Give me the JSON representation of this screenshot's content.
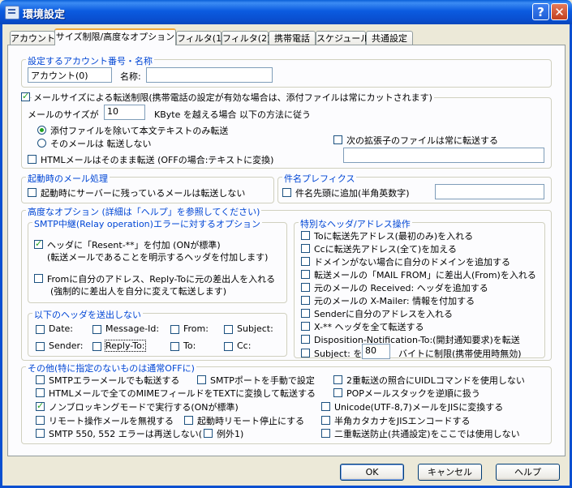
{
  "window": {
    "title": "環境設定",
    "help_btn": "?",
    "close_btn": "✕"
  },
  "tabs": [
    {
      "label": "アカウント",
      "active": false
    },
    {
      "label": "サイズ制限/高度なオプション",
      "active": true
    },
    {
      "label": "フィルタ(1)",
      "active": false
    },
    {
      "label": "フィルタ(2)",
      "active": false
    },
    {
      "label": "携帯電話",
      "active": false
    },
    {
      "label": "スケジュール",
      "active": false
    },
    {
      "label": "共通設定",
      "active": false
    }
  ],
  "account": {
    "group_title": "設定するアカウント番号・名称",
    "number_value": "アカウント(0)",
    "name_label": "名称:",
    "name_value": ""
  },
  "size_limit": {
    "enable_label": "メールサイズによる転送制限(携帯電話の設定が有効な場合は、添付ファイルは常にカットされます)",
    "size_prefix": "メールのサイズが",
    "size_value": "10",
    "size_suffix": "KByte を越える場合 以下の方法に従う",
    "radio_strip": "添付ファイルを除いて本文テキストのみ転送",
    "radio_skip": "そのメールは 転送しない",
    "html_label": "HTMLメールはそのまま転送 (OFFの場合:テキストに変換)",
    "ext_label": "次の拡張子のファイルは常に転送する",
    "ext_value": ""
  },
  "startup": {
    "group_title": "起動時のメール処理",
    "skip_label": "起動時にサーバーに残っているメールは転送しない"
  },
  "prefix": {
    "group_title": "件名プレフィクス",
    "add_label": "件名先頭に追加(半角英数字)",
    "value": ""
  },
  "advanced": {
    "group_title": "高度なオプション (詳細は「ヘルプ」を参照してください)",
    "smtp_title": "SMTP中継(Relay operation)エラーに対するオプション",
    "resent_line1": "ヘッダに「Resent-**」を付加 (ONが標準)",
    "resent_line2": "(転送メールであることを明示するヘッダを付加します)",
    "from_line1": "Fromに自分のアドレス、Reply-Toに元の差出人を入れる",
    "from_line2": "(強制的に差出人を自分に変えて転送します)",
    "noheader_title": "以下のヘッダを送出しない",
    "headers": [
      "Date:",
      "Message-Id:",
      "From:",
      "Subject:",
      "Sender:",
      "Reply-To:",
      "To:",
      "Cc:"
    ]
  },
  "special": {
    "group_title": "特別なヘッダ/アドレス操作",
    "items": [
      "Toに転送先アドレス(最初のみ)を入れる",
      "Ccに転送先アドレス(全て)を加える",
      "ドメインがない場合に自分のドメインを追加する",
      "転送メールの「MAIL FROM」に差出人(From)を入れる",
      "元のメールの Received: ヘッダを追加する",
      "元のメールの X-Mailer: 情報を付加する",
      "Senderに自分のアドレスを入れる",
      "X-** ヘッダを全て転送する",
      "Disposition-Notification-To:(開封通知要求)を転送"
    ],
    "subject_prefix": "Subject: を",
    "subject_value": "80",
    "subject_suffix": "バイトに制限(携帯使用時無効)"
  },
  "other": {
    "group_title": "その他(特に指定のないものは通常OFFに)",
    "col1": [
      {
        "label": "SMTPエラーメールでも転送する",
        "checked": false
      },
      {
        "label": "HTMLメールで全てのMIMEフィールドをTEXTに変換して転送する",
        "checked": false
      },
      {
        "label": "ノンブロッキングモードで実行する(ONが標準)",
        "checked": true
      },
      {
        "label": "リモート操作メールを無視する",
        "checked": false
      },
      {
        "label": "SMTP 550, 552 エラーは再送しない(",
        "checked": false
      }
    ],
    "col2": [
      {
        "label": "SMTPポートを手動で設定",
        "checked": false
      },
      {
        "label": "起動時リモート停止にする",
        "checked": false
      },
      {
        "label": "例外1)",
        "checked": false
      }
    ],
    "col3": [
      {
        "label": "2重転送の照合にUIDLコマンドを使用しない",
        "checked": false
      },
      {
        "label": "POPメールスタックを逆順に扱う",
        "checked": false
      },
      {
        "label": "Unicode(UTF-8,7)メールをJISに変換する",
        "checked": false
      },
      {
        "label": "半角カタカナをJISエンコードする",
        "checked": false
      },
      {
        "label": "二重転送防止(共通設定)をここでは使用しない",
        "checked": false
      }
    ]
  },
  "footer": {
    "ok": "OK",
    "cancel": "キャンセル",
    "help": "ヘルプ"
  },
  "colors": {
    "group_title": "#0046d5",
    "titlebar": "#0a5fd8",
    "face": "#ece9d8"
  }
}
